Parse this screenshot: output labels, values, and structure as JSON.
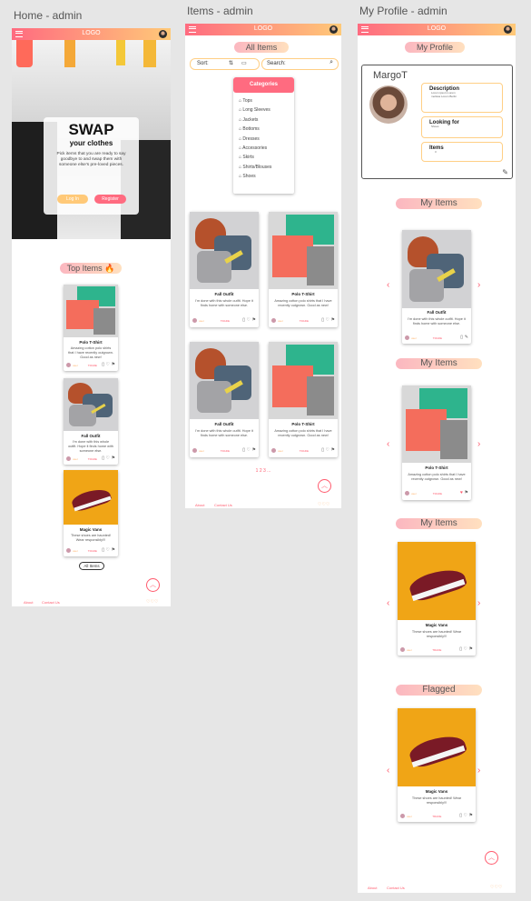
{
  "artboards": {
    "home": "Home - admin",
    "items": "Items - admin",
    "profile": "My Profile - admin"
  },
  "logo": "LOGO",
  "home": {
    "hero_title": "SWAP",
    "hero_subtitle": "your clothes",
    "hero_text": "Pick items that you are ready to say goodbye to and swap them with someone else's pre-loved pieces.",
    "login": "Log In",
    "register": "Register",
    "top_items": "Top Items 🔥",
    "cards": [
      {
        "title": "Polo T-Shirt",
        "desc": "Amazing cotton polo shirts that I have recently outgrown. Good as new!",
        "user": "user",
        "trade": "TRADE"
      },
      {
        "title": "Fall Outfit",
        "desc": "I'm done with this whole outfit. Hope it finds home with someone else.",
        "user": "user",
        "trade": "TRADE"
      },
      {
        "title": "Magic Vans",
        "desc": "These shoes are haunted! Wear responsibly!!!",
        "user": "user",
        "trade": "TRADE"
      }
    ],
    "all_items": "All Items",
    "about": "About",
    "contact": "Contact Us"
  },
  "items": {
    "heading": "All Items",
    "sort": "Sort:",
    "search": "Search:",
    "categories": "Categories",
    "cat_list": [
      "Tops",
      "Long Sleeves",
      "Jackets",
      "Bottoms",
      "Dresses",
      "Accessories",
      "Skirts",
      "Shirts/Blouses",
      "Shoes"
    ],
    "cards": [
      {
        "title": "Fall Outfit",
        "desc": "I'm done with this whole outfit. Hope it finds home with someone else.",
        "user": "user",
        "trade": "TRADE"
      },
      {
        "title": "Polo T-Shirt",
        "desc": "Amazing cotton polo shirts that I have recently outgrown. Good as new!",
        "user": "user",
        "trade": "TRADE"
      },
      {
        "title": "Fall Outfit",
        "desc": "I'm done with this whole outfit. Hope it finds home with someone else.",
        "user": "user",
        "trade": "TRADE"
      },
      {
        "title": "Polo T-Shirt",
        "desc": "Amazing cotton polo shirts that I have recently outgrown. Good as new!",
        "user": "user",
        "trade": "TRADE"
      }
    ],
    "pagination": "1 2 3 ...",
    "about": "About",
    "contact": "Contact Us"
  },
  "profile": {
    "heading": "My Profile",
    "name": "MargoT",
    "desc_h": "Description",
    "desc_t": "Lorem ipsum Lorem melissa Lorem Berlin",
    "look_h": "Looking for",
    "look_t": "Shoes",
    "items_h": "Items",
    "items_t": "3",
    "sections": [
      {
        "label": "My Items",
        "title": "Fall Outfit",
        "desc": "I'm done with this whole outfit. Hope it finds home with someone else.",
        "user": "user",
        "trade": "TRADE"
      },
      {
        "label": "My Items",
        "title": "Polo T-Shirt",
        "desc": "Amazing cotton polo shirts that I have recently outgrown. Good as new!",
        "user": "user",
        "trade": "TRADE"
      },
      {
        "label": "My Items",
        "title": "Magic Vans",
        "desc": "These shoes are haunted! Wear responsibly!!!",
        "user": "user",
        "trade": "TRADE"
      },
      {
        "label": "Flagged",
        "title": "Magic Vans",
        "desc": "These shoes are haunted! Wear responsibly!!!",
        "user": "user",
        "trade": "TRADE"
      }
    ],
    "about": "About",
    "contact": "Contact Us"
  }
}
